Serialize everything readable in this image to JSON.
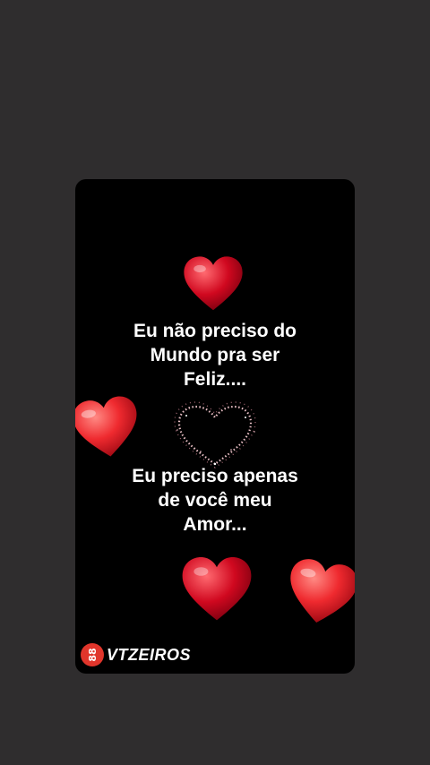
{
  "message": {
    "top_lines": [
      "Eu não preciso do",
      "Mundo pra ser",
      "Feliz...."
    ],
    "bottom_lines": [
      "Eu preciso apenas",
      "de você meu",
      "Amor..."
    ]
  },
  "watermark": {
    "logo_text": "88",
    "text": "VTZEIROS"
  },
  "icons": [
    "heart-icon",
    "sparkle-heart-icon"
  ],
  "colors": {
    "background": "#2f2d2e",
    "card": "#000000",
    "heart_red": "#d8102a",
    "heart_bright": "#f0323a",
    "sparkle": "#f6c9d0"
  }
}
